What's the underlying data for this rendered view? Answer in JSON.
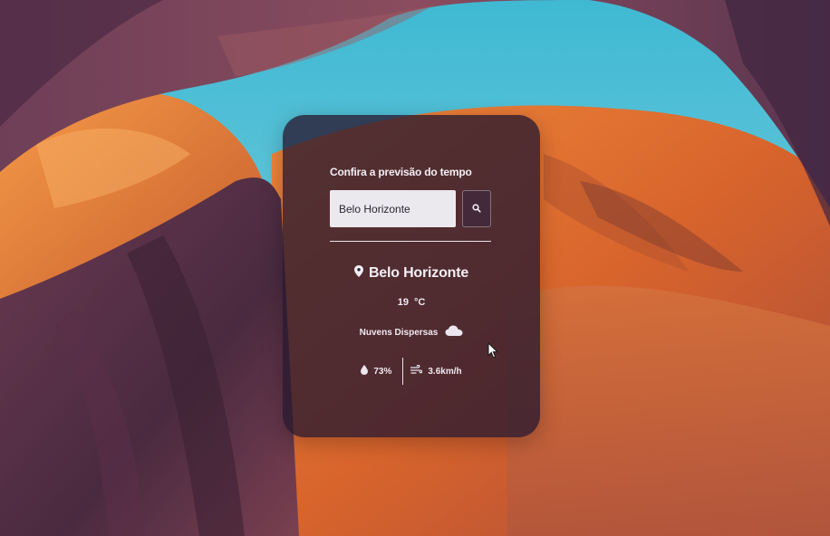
{
  "colors": {
    "sky": "#4fc0d6",
    "rock_orange": "#e07a3a",
    "rock_dark": "#4a2a3e",
    "card_bg": "rgba(40,24,48,0.78)",
    "input_bg": "#ece9ee",
    "text": "#f1eef2"
  },
  "weather_card": {
    "title": "Confira a previsão do tempo",
    "search": {
      "value": "Belo Horizonte",
      "placeholder": "",
      "button_icon": "search-icon"
    },
    "result": {
      "location_icon": "map-pin-icon",
      "city": "Belo Horizonte",
      "temperature": "19",
      "unit": "°C",
      "description": "Nuvens Dispersas",
      "description_icon": "cloud-icon",
      "humidity_icon": "droplet-icon",
      "humidity": "73%",
      "wind_icon": "wind-icon",
      "wind": "3.6km/h"
    }
  },
  "cursor_icon": "mouse-pointer-icon"
}
